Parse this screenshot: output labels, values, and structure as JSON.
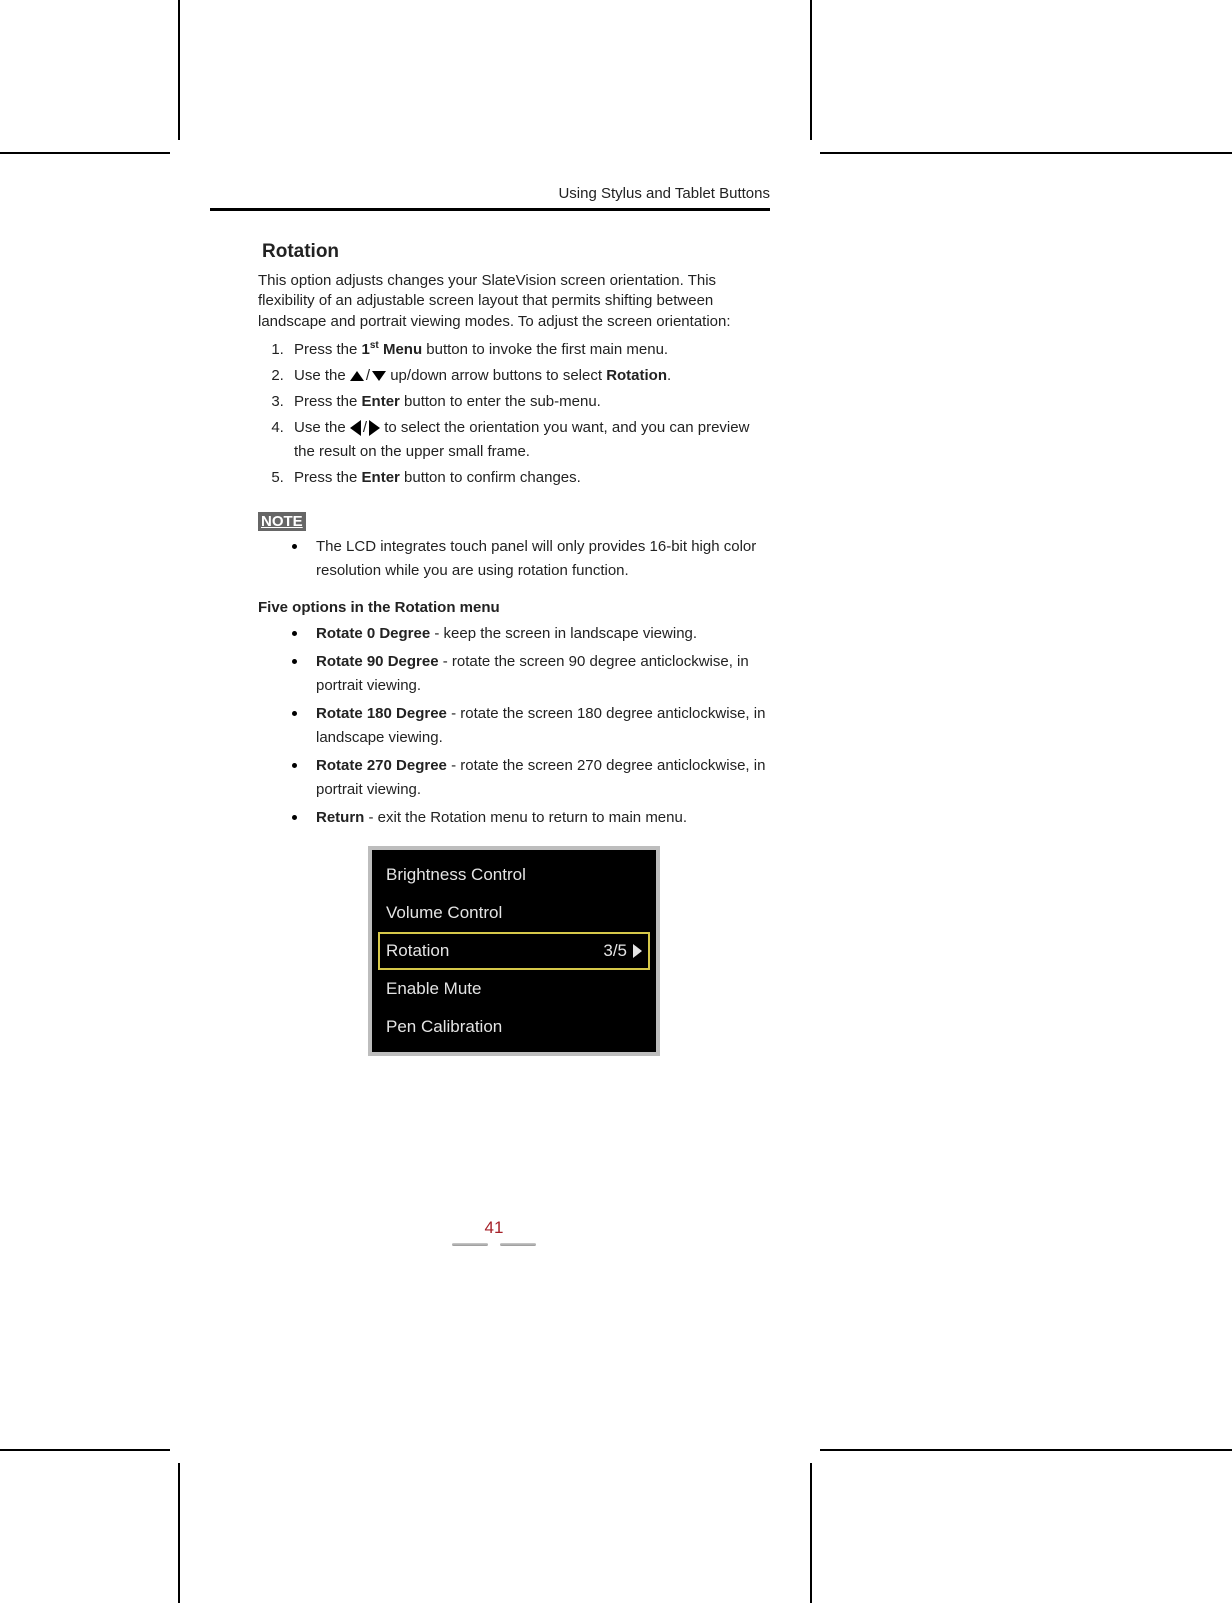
{
  "header": {
    "running_head": "Using Stylus and Tablet Buttons"
  },
  "section": {
    "title": "Rotation",
    "intro": "This option adjusts changes your SlateVision screen orientation.  This flexibility of an adjustable screen layout that permits shifting between landscape and portrait viewing modes. To adjust the screen orientation:",
    "steps": {
      "s1_a": "Press the ",
      "s1_b_bold": "1",
      "s1_sup": "st",
      "s1_c_bold": " Menu",
      "s1_d": " button to invoke the first main menu.",
      "s2_a": "Use the ",
      "s2_b": " up/down arrow buttons to select ",
      "s2_bold": "Rotation",
      "s2_c": ".",
      "s3_a": "Press the ",
      "s3_bold": "Enter",
      "s3_b": " button to enter the sub-menu.",
      "s4_a": "Use the ",
      "s4_b": " to select the orientation you want, and you can preview the result on the upper small frame.",
      "s5_a": "Press the ",
      "s5_bold": "Enter",
      "s5_b": " button to confirm changes."
    },
    "note_label": "NOTE",
    "note_item": "The LCD integrates touch panel will only provides 16-bit high color resolution while you are using rotation function.",
    "options_heading": "Five options in the Rotation menu",
    "options": [
      {
        "bold": "Rotate 0 Degree",
        "rest": " - keep the screen in landscape viewing."
      },
      {
        "bold": "Rotate 90 Degree",
        "rest": " - rotate the screen 90 degree anticlockwise, in portrait viewing."
      },
      {
        "bold": "Rotate 180 Degree",
        "rest": " - rotate the screen 180 degree anticlockwise, in landscape viewing."
      },
      {
        "bold": "Rotate 270 Degree",
        "rest": " - rotate the screen 270 degree anticlockwise, in portrait viewing."
      },
      {
        "bold": "Return",
        "rest": " - exit the Rotation menu to return to main menu."
      }
    ]
  },
  "device_menu": {
    "items": [
      {
        "label": "Brightness Control",
        "selected": false,
        "indicator": ""
      },
      {
        "label": "Volume Control",
        "selected": false,
        "indicator": ""
      },
      {
        "label": "Rotation",
        "selected": true,
        "indicator": "3/5"
      },
      {
        "label": "Enable Mute",
        "selected": false,
        "indicator": ""
      },
      {
        "label": "Pen Calibration",
        "selected": false,
        "indicator": ""
      }
    ]
  },
  "footer": {
    "page_number": "41"
  }
}
